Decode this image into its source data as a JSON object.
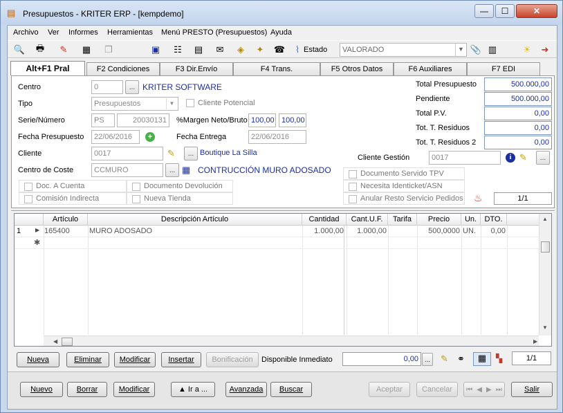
{
  "window": {
    "title": "Presupuestos - KRITER ERP - [kempdemo]",
    "min": "—",
    "max": "☐",
    "close": "✕"
  },
  "menu": [
    "Archivo",
    "Ver",
    "Informes",
    "Herramientas",
    "Menú PRESTO (Presupuestos)",
    "Ayuda"
  ],
  "toolbar": {
    "estado_label": "Estado",
    "estado_value": "VALORADO"
  },
  "tabs": [
    "Alt+F1 Pral",
    "F2 Condiciones",
    "F3 Dir.Envío",
    "F4 Trans.",
    "F5 Otros Datos",
    "F6 Auxiliares",
    "F7 EDI"
  ],
  "form": {
    "centro_label": "Centro",
    "centro_value": "0",
    "centro_name": "KRITER SOFTWARE",
    "tipo_label": "Tipo",
    "tipo_value": "Presupuestos",
    "cliente_potencial": "Cliente Potencial",
    "serie_label": "Serie/Número",
    "serie_value": "PS",
    "numero_value": "20030131",
    "margen_label": "%Margen Neto/Bruto",
    "margen_neto": "100,00",
    "margen_bruto": "100,00",
    "fecha_presupuesto_label": "Fecha Presupuesto",
    "fecha_presupuesto": "22/06/2016",
    "fecha_entrega_label": "Fecha Entrega",
    "fecha_entrega": "22/06/2016",
    "cliente_label": "Cliente",
    "cliente_value": "0017",
    "cliente_name": "Boutique La Silla",
    "cliente_gestion_label": "Cliente Gestión",
    "cliente_gestion_value": "0017",
    "centro_coste_label": "Centro de Coste",
    "centro_coste_value": "CCMURO",
    "centro_coste_name": "CONTRUCCIÓN MURO ADOSADO",
    "checks": [
      "Doc. A Cuenta",
      "Documento Devolución",
      "Comisión Indirecta",
      "Nueva Tienda",
      "Documento Servido TPV",
      "Necesita Identicket/ASN",
      "Anular Resto Servicio Pedidos"
    ],
    "page_counter": "1/1"
  },
  "totals": [
    {
      "label": "Total Presupuesto",
      "value": "500.000,00"
    },
    {
      "label": "Pendiente",
      "value": "500.000,00"
    },
    {
      "label": "Total P.V.",
      "value": "0,00"
    },
    {
      "label": "Tot. T. Residuos",
      "value": "0,00"
    },
    {
      "label": "Tot. T. Residuos 2",
      "value": "0,00"
    }
  ],
  "grid": {
    "headers": [
      "Artículo",
      "Descripción Artículo",
      "Cantidad",
      "Cant.U.F.",
      "Tarifa",
      "Precio",
      "Un.",
      "DTO."
    ],
    "rows": [
      {
        "num": "1",
        "articulo": "165400",
        "descripcion": "MURO ADOSADO",
        "cantidad": "1.000,00",
        "cant_uf": "1.000,00",
        "tarifa": "",
        "precio": "500,0000",
        "un": "UN.",
        "dto": "0,00"
      }
    ]
  },
  "line_actions": {
    "nueva": "Nueva",
    "eliminar": "Eliminar",
    "modificar": "Modificar",
    "insertar": "Insertar",
    "bonificacion": "Bonificación",
    "disponible_label": "Disponible Inmediato",
    "disponible_value": "0,00",
    "counter": "1/1"
  },
  "footer": {
    "nuevo": "Nuevo",
    "borrar": "Borrar",
    "modificar": "Modificar",
    "ira": "▲ Ir a ...",
    "avanzada": "Avanzada",
    "buscar": "Buscar",
    "aceptar": "Aceptar",
    "cancelar": "Cancelar",
    "salir": "Salir"
  }
}
